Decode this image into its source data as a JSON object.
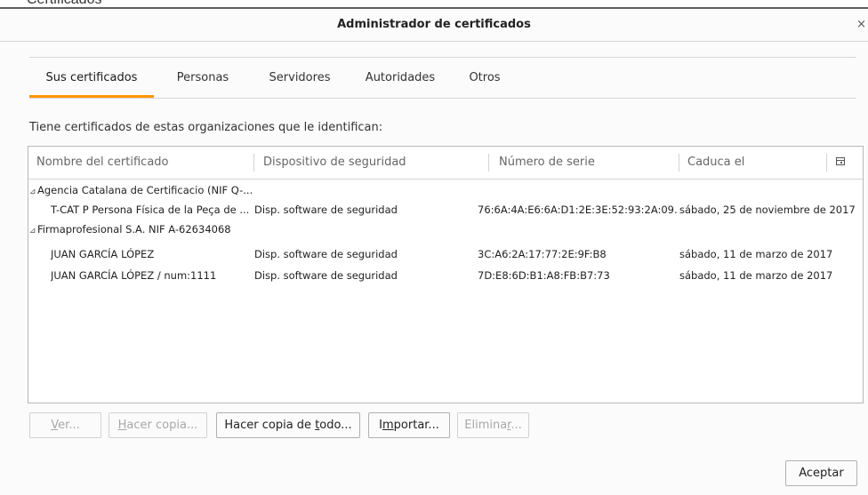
{
  "backdrop": {
    "partial_text": "Certificados"
  },
  "dialog": {
    "title": "Administrador de certificados",
    "close_glyph": "×"
  },
  "tabs": [
    {
      "label": "Sus certificados",
      "active": true
    },
    {
      "label": "Personas"
    },
    {
      "label": "Servidores"
    },
    {
      "label": "Autoridades"
    },
    {
      "label": "Otros"
    }
  ],
  "intro": "Tiene certificados de estas organizaciones que le identifican:",
  "table": {
    "columns": [
      "Nombre del certificado",
      "Dispositivo de seguridad",
      "Número de serie",
      "Caduca el"
    ],
    "column_picker_icon": "column-picker-icon",
    "groups": [
      {
        "name": "Agencia Catalana de Certificacio (NIF Q-...",
        "rows": [
          {
            "name": "T-CAT P Persona Física de la Peça de ...",
            "device": "Disp. software de seguridad",
            "serial": "76:6A:4A:E6:6A:D1:2E:3E:52:93:2A:09...",
            "expires": "sábado, 25 de noviembre de 2017"
          }
        ]
      },
      {
        "name": "Firmaprofesional S.A. NIF A-62634068",
        "rows": [
          {
            "name": "JUAN GARCÍA LÓPEZ",
            "device": "Disp. software de seguridad",
            "serial": "3C:A6:2A:17:77:2E:9F:B8",
            "expires": "sábado, 11 de marzo de 2017"
          },
          {
            "name": "JUAN GARCÍA LÓPEZ / num:1111",
            "device": "Disp. software de seguridad",
            "serial": "7D:E8:6D:B1:A8:FB:B7:73",
            "expires": "sábado, 11 de marzo de 2017"
          }
        ]
      }
    ]
  },
  "buttons": {
    "view": {
      "pre": "",
      "key": "V",
      "post": "er..."
    },
    "backup": {
      "pre": "",
      "key": "H",
      "post": "acer copia..."
    },
    "backup_all": {
      "pre": "Hacer copia de ",
      "key": "t",
      "post": "odo..."
    },
    "import": {
      "pre": "I",
      "key": "m",
      "post": "portar..."
    },
    "delete": {
      "pre": "Elimina",
      "key": "r",
      "post": "..."
    },
    "ok": "Aceptar"
  }
}
